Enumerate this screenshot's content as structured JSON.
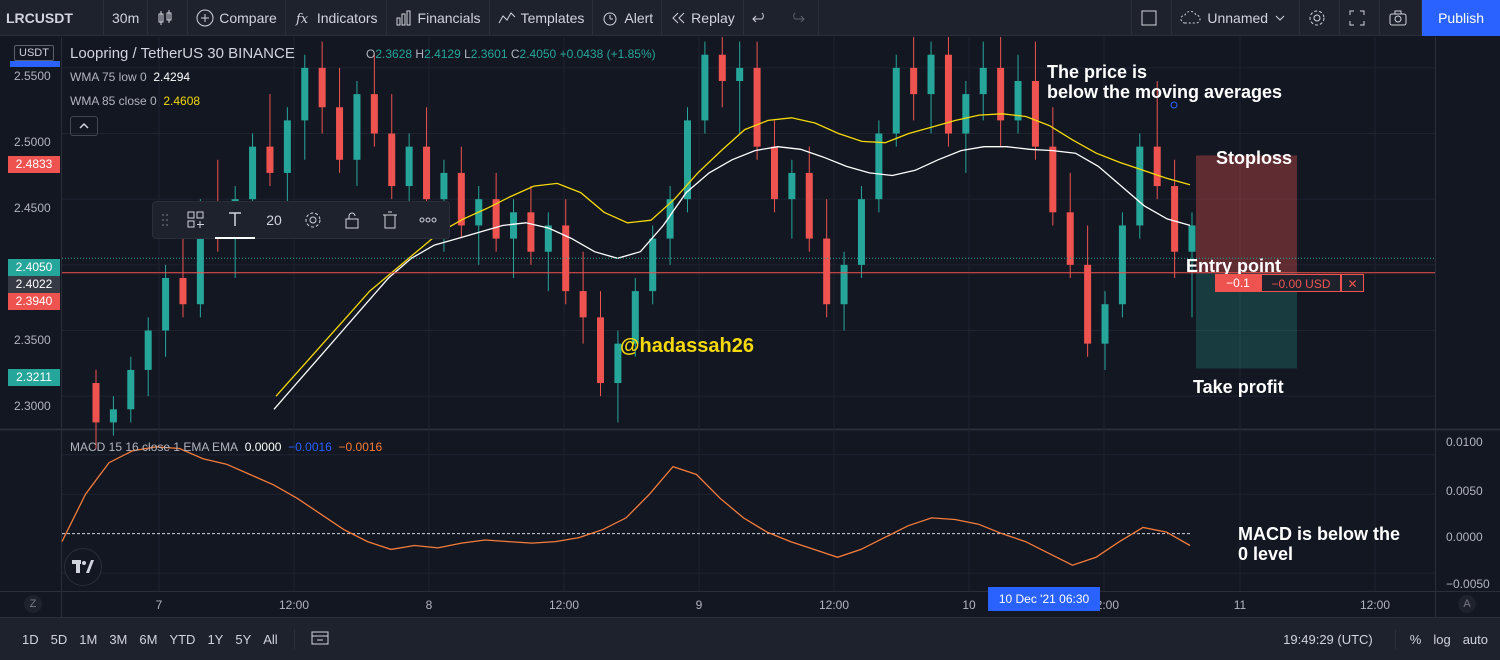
{
  "toolbar": {
    "symbol": "LRCUSDT",
    "interval": "30m",
    "compare": "Compare",
    "indicators": "Indicators",
    "financials": "Financials",
    "templates": "Templates",
    "alert": "Alert",
    "replay": "Replay",
    "layout_name": "Unnamed",
    "publish": "Publish"
  },
  "legend": {
    "title": "Loopring / TetherUS  30  BINANCE",
    "ohlc": {
      "o_key": "O",
      "o": "2.3628",
      "h_key": "H",
      "h": "2.4129",
      "l_key": "L",
      "l": "2.3601",
      "c_key": "C",
      "c": "2.4050",
      "change": "+0.0438 (+1.85%)"
    },
    "wma75_label": "WMA 75 low 0",
    "wma75_value": "2.4294",
    "wma85_label": "WMA 85 close 0",
    "wma85_value": "2.4608",
    "macd_label": "MACD 15 16 close 1 EMA EMA",
    "macd_v1": "0.0000",
    "macd_v2": "−0.0016",
    "macd_v3": "−0.0016"
  },
  "price_scale": {
    "currency": "USDT",
    "ticks": [
      "2.5500",
      "2.5000",
      "2.4500",
      "2.3500",
      "2.3000"
    ],
    "labels": {
      "stoploss": "2.4833",
      "last": "2.4050",
      "crosshair": "2.4022",
      "entry": "2.3940",
      "takeprofit": "2.3211"
    }
  },
  "macd_scale": {
    "ticks": [
      "0.0100",
      "0.0050",
      "0.0000",
      "−0.0050"
    ]
  },
  "drawing_toolbar": {
    "font_size": "20"
  },
  "annotations": {
    "price_below_1": "The price is",
    "price_below_2": "below the moving averages",
    "stoploss": "Stoploss",
    "entry": "Entry point",
    "takeprofit": "Take profit",
    "macd_1": "MACD is below the",
    "macd_2": "0 level",
    "watermark": "@hadassah26"
  },
  "position": {
    "qty": "−0.1",
    "pnl": "−0.00 USD",
    "close": "✕"
  },
  "time_axis": {
    "ticks": [
      "7",
      "12:00",
      "8",
      "12:00",
      "9",
      "12:00",
      "10",
      "12:00",
      "11",
      "12:00"
    ],
    "crosshair": "10 Dec '21   06:30",
    "left_btn": "Z",
    "right_btn": "A"
  },
  "bottom_bar": {
    "ranges": [
      "1D",
      "5D",
      "1M",
      "3M",
      "6M",
      "YTD",
      "1Y",
      "5Y",
      "All"
    ],
    "clock": "19:49:29 (UTC)",
    "percent": "%",
    "log": "log",
    "auto": "auto"
  },
  "colors": {
    "background": "#131722",
    "up": "#26a69a",
    "down": "#ef5350",
    "wma75": "#ffffff",
    "wma85": "#f5d90a",
    "macd": "#f57c3a",
    "accent": "#2962ff"
  },
  "chart_data": {
    "type": "candlestick",
    "series_names": [
      "LRCUSDT",
      "WMA 75",
      "WMA 85",
      "MACD"
    ],
    "ylim": [
      2.275,
      2.5735
    ],
    "macd_ylim": [
      -0.006,
      0.012
    ],
    "candles": [
      [
        2.31,
        2.32,
        2.26,
        2.28
      ],
      [
        2.28,
        2.3,
        2.27,
        2.29
      ],
      [
        2.29,
        2.33,
        2.28,
        2.32
      ],
      [
        2.32,
        2.36,
        2.3,
        2.35
      ],
      [
        2.35,
        2.4,
        2.33,
        2.39
      ],
      [
        2.39,
        2.42,
        2.36,
        2.37
      ],
      [
        2.37,
        2.45,
        2.36,
        2.44
      ],
      [
        2.44,
        2.48,
        2.41,
        2.42
      ],
      [
        2.42,
        2.46,
        2.39,
        2.45
      ],
      [
        2.45,
        2.5,
        2.43,
        2.49
      ],
      [
        2.49,
        2.53,
        2.46,
        2.47
      ],
      [
        2.47,
        2.52,
        2.44,
        2.51
      ],
      [
        2.51,
        2.56,
        2.48,
        2.55
      ],
      [
        2.55,
        2.57,
        2.5,
        2.52
      ],
      [
        2.52,
        2.55,
        2.47,
        2.48
      ],
      [
        2.48,
        2.54,
        2.46,
        2.53
      ],
      [
        2.53,
        2.56,
        2.49,
        2.5
      ],
      [
        2.5,
        2.53,
        2.45,
        2.46
      ],
      [
        2.46,
        2.5,
        2.43,
        2.49
      ],
      [
        2.49,
        2.52,
        2.44,
        2.45
      ],
      [
        2.45,
        2.48,
        2.41,
        2.47
      ],
      [
        2.47,
        2.49,
        2.42,
        2.43
      ],
      [
        2.43,
        2.46,
        2.4,
        2.45
      ],
      [
        2.45,
        2.47,
        2.41,
        2.42
      ],
      [
        2.42,
        2.45,
        2.39,
        2.44
      ],
      [
        2.44,
        2.46,
        2.4,
        2.41
      ],
      [
        2.41,
        2.44,
        2.38,
        2.43
      ],
      [
        2.43,
        2.45,
        2.37,
        2.38
      ],
      [
        2.38,
        2.41,
        2.34,
        2.36
      ],
      [
        2.36,
        2.38,
        2.3,
        2.31
      ],
      [
        2.31,
        2.35,
        2.28,
        2.34
      ],
      [
        2.34,
        2.39,
        2.33,
        2.38
      ],
      [
        2.38,
        2.43,
        2.37,
        2.42
      ],
      [
        2.42,
        2.46,
        2.4,
        2.45
      ],
      [
        2.45,
        2.52,
        2.44,
        2.51
      ],
      [
        2.51,
        2.57,
        2.5,
        2.56
      ],
      [
        2.56,
        2.58,
        2.52,
        2.54
      ],
      [
        2.54,
        2.57,
        2.5,
        2.55
      ],
      [
        2.55,
        2.57,
        2.48,
        2.49
      ],
      [
        2.49,
        2.51,
        2.44,
        2.45
      ],
      [
        2.45,
        2.48,
        2.42,
        2.47
      ],
      [
        2.47,
        2.49,
        2.41,
        2.42
      ],
      [
        2.42,
        2.45,
        2.36,
        2.37
      ],
      [
        2.37,
        2.41,
        2.35,
        2.4
      ],
      [
        2.4,
        2.46,
        2.39,
        2.45
      ],
      [
        2.45,
        2.51,
        2.44,
        2.5
      ],
      [
        2.5,
        2.56,
        2.49,
        2.55
      ],
      [
        2.55,
        2.58,
        2.51,
        2.53
      ],
      [
        2.53,
        2.57,
        2.5,
        2.56
      ],
      [
        2.56,
        2.58,
        2.49,
        2.5
      ],
      [
        2.5,
        2.54,
        2.47,
        2.53
      ],
      [
        2.53,
        2.57,
        2.51,
        2.55
      ],
      [
        2.55,
        2.58,
        2.49,
        2.51
      ],
      [
        2.51,
        2.56,
        2.5,
        2.54
      ],
      [
        2.54,
        2.57,
        2.48,
        2.49
      ],
      [
        2.49,
        2.52,
        2.43,
        2.44
      ],
      [
        2.44,
        2.47,
        2.39,
        2.4
      ],
      [
        2.4,
        2.43,
        2.33,
        2.34
      ],
      [
        2.34,
        2.38,
        2.32,
        2.37
      ],
      [
        2.37,
        2.44,
        2.36,
        2.43
      ],
      [
        2.43,
        2.5,
        2.42,
        2.49
      ],
      [
        2.49,
        2.54,
        2.45,
        2.46
      ],
      [
        2.46,
        2.48,
        2.39,
        2.41
      ],
      [
        2.41,
        2.44,
        2.36,
        2.43
      ]
    ],
    "wma75": [
      2.29,
      2.31,
      2.33,
      2.35,
      2.37,
      2.39,
      2.405,
      2.415,
      2.42,
      2.425,
      2.43,
      2.432,
      2.428,
      2.42,
      2.41,
      2.405,
      2.41,
      2.43,
      2.455,
      2.47,
      2.48,
      2.487,
      2.49,
      2.488,
      2.482,
      2.475,
      2.47,
      2.468,
      2.472,
      2.48,
      2.487,
      2.49,
      2.49,
      2.488,
      2.487,
      2.485,
      2.475,
      2.46,
      2.445,
      2.435,
      2.43
    ],
    "wma85": [
      2.3,
      2.32,
      2.34,
      2.36,
      2.38,
      2.395,
      2.41,
      2.425,
      2.435,
      2.443,
      2.452,
      2.46,
      2.462,
      2.455,
      2.44,
      2.432,
      2.434,
      2.45,
      2.47,
      2.487,
      2.503,
      2.51,
      2.512,
      2.508,
      2.5,
      2.494,
      2.493,
      2.5,
      2.505,
      2.51,
      2.514,
      2.515,
      2.513,
      2.506,
      2.495,
      2.485,
      2.478,
      2.472,
      2.466,
      2.461
    ],
    "macd": [
      -0.001,
      0.005,
      0.009,
      0.0105,
      0.011,
      0.0108,
      0.0095,
      0.0088,
      0.0075,
      0.0062,
      0.0045,
      0.0025,
      0.0005,
      -0.001,
      -0.002,
      -0.0015,
      -0.0018,
      -0.0012,
      -0.0008,
      -0.001,
      -0.0012,
      -0.001,
      -0.0005,
      0.0005,
      0.002,
      0.005,
      0.0085,
      0.0075,
      0.0045,
      0.002,
      0.0002,
      -0.001,
      -0.002,
      -0.003,
      -0.002,
      -0.0005,
      0.001,
      0.002,
      0.0018,
      0.0012,
      0.0,
      -0.001,
      -0.0025,
      -0.004,
      -0.003,
      -0.001,
      0.0008,
      0.0002,
      -0.0015
    ]
  }
}
